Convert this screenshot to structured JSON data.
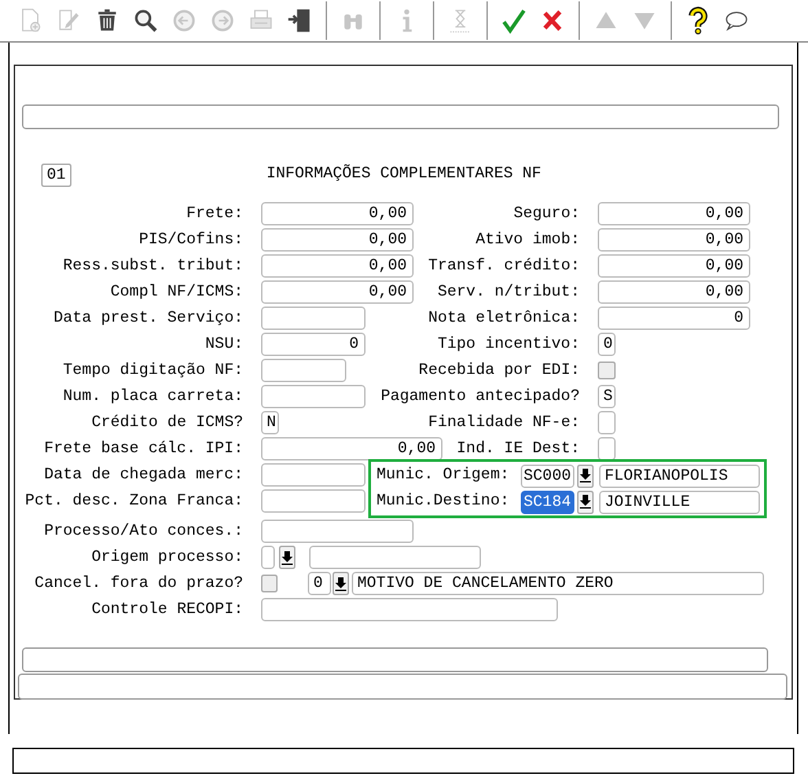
{
  "toolbar": [
    {
      "kind": "new",
      "disabled": true
    },
    {
      "kind": "edit",
      "disabled": true
    },
    {
      "kind": "delete",
      "disabled": false
    },
    {
      "kind": "search",
      "disabled": false
    },
    {
      "kind": "prev",
      "disabled": true
    },
    {
      "kind": "next",
      "disabled": true
    },
    {
      "kind": "print",
      "disabled": true
    },
    {
      "kind": "exit",
      "disabled": false
    },
    {
      "kind": "sep"
    },
    {
      "kind": "binoculars",
      "disabled": true
    },
    {
      "kind": "sep"
    },
    {
      "kind": "info",
      "disabled": true
    },
    {
      "kind": "sep"
    },
    {
      "kind": "hourglass",
      "disabled": true
    },
    {
      "kind": "sep"
    },
    {
      "kind": "confirm",
      "disabled": false
    },
    {
      "kind": "cancel",
      "disabled": false
    },
    {
      "kind": "sep"
    },
    {
      "kind": "up",
      "disabled": true
    },
    {
      "kind": "down",
      "disabled": true
    },
    {
      "kind": "sep"
    },
    {
      "kind": "help",
      "disabled": false
    },
    {
      "kind": "chat",
      "disabled": false
    }
  ],
  "form": {
    "page": "01",
    "title": "INFORMAÇÕES COMPLEMENTARES NF",
    "rows_top": [
      {
        "left": {
          "label": "Frete:",
          "fields": [
            {
              "kind": "text",
              "value": "0,00"
            }
          ]
        },
        "right": {
          "label": "Seguro:",
          "fields": [
            {
              "kind": "text",
              "value": "0,00"
            }
          ]
        }
      },
      {
        "left": {
          "label": "PIS/Cofins:",
          "fields": [
            {
              "kind": "text",
              "value": "0,00"
            }
          ]
        },
        "right": {
          "label": "Ativo imob:",
          "fields": [
            {
              "kind": "text",
              "value": "0,00"
            }
          ]
        }
      },
      {
        "left": {
          "label": "Ress.subst. tribut:",
          "fields": [
            {
              "kind": "text",
              "value": "0,00"
            }
          ]
        },
        "right": {
          "label": "Transf. crédito:",
          "fields": [
            {
              "kind": "text",
              "value": "0,00"
            }
          ]
        }
      },
      {
        "left": {
          "label": "Compl NF/ICMS:",
          "fields": [
            {
              "kind": "text",
              "value": "0,00"
            }
          ]
        },
        "right": {
          "label": "Serv. n/tribut:",
          "fields": [
            {
              "kind": "text",
              "value": "0,00"
            }
          ]
        }
      },
      {
        "left": {
          "label": "Data prest. Serviço:",
          "fields": [
            {
              "kind": "text"
            }
          ]
        },
        "right": {
          "label": "Nota eletrônica:",
          "fields": [
            {
              "kind": "text",
              "value": "0"
            }
          ]
        }
      },
      {
        "left": {
          "label": "NSU:",
          "fields": [
            {
              "kind": "text",
              "value": "0"
            }
          ]
        },
        "right": {
          "label": "Tipo incentivo:",
          "fields": [
            {
              "kind": "text",
              "value": "0"
            }
          ]
        }
      },
      {
        "left": {
          "label": "Tempo digitação NF:",
          "fields": [
            {
              "kind": "text"
            }
          ]
        },
        "right": {
          "label": "Recebida por EDI:",
          "fields": [
            {
              "kind": "checkbox",
              "checked": false
            }
          ]
        }
      },
      {
        "left": {
          "label": "Num. placa carreta:",
          "fields": [
            {
              "kind": "text"
            }
          ]
        },
        "right": {
          "label": "Pagamento antecipado?",
          "fields": [
            {
              "kind": "text",
              "value": "S"
            }
          ]
        }
      },
      {
        "left": {
          "label": "Crédito de ICMS?",
          "fields": [
            {
              "kind": "text",
              "value": "N"
            }
          ]
        },
        "right": {
          "label": "Finalidade NF-e:",
          "fields": [
            {
              "kind": "text"
            }
          ]
        }
      },
      {
        "left": {
          "label": "Frete base cálc. IPI:",
          "fields": [
            {
              "kind": "text",
              "value": "0,00"
            }
          ]
        },
        "right": {
          "label": "Ind. IE Dest:",
          "fields": [
            {
              "kind": "text"
            }
          ]
        }
      }
    ],
    "rows_mid": [
      {
        "left": {
          "label": "Data de chegada merc:",
          "fields": [
            {
              "kind": "text"
            }
          ]
        }
      },
      {
        "left": {
          "label": "Pct. desc. Zona Franca:",
          "fields": [
            {
              "kind": "text"
            }
          ]
        }
      }
    ],
    "municipios": [
      {
        "label": "Munic. Origem:",
        "code": "SC000",
        "name": "FLORIANOPOLIS",
        "selected": false
      },
      {
        "label": "Munic.Destino:",
        "code": "SC184",
        "name": "JOINVILLE",
        "selected": true
      }
    ],
    "rows_bottom": [
      {
        "left": {
          "label": "Processo/Ato conces.:",
          "fields": [
            {
              "kind": "text"
            }
          ]
        }
      },
      {
        "left": {
          "label": "Origem processo:",
          "fields": [
            {
              "kind": "text"
            },
            {
              "kind": "dropdown"
            },
            {
              "kind": "text"
            }
          ]
        }
      },
      {
        "left": {
          "label": "Cancel. fora do prazo?",
          "fields": [
            {
              "kind": "checkbox",
              "checked": false
            },
            {
              "kind": "text",
              "value": "0"
            },
            {
              "kind": "dropdown"
            },
            {
              "kind": "text",
              "value": "MOTIVO DE CANCELAMENTO ZERO"
            }
          ]
        }
      },
      {
        "left": {
          "label": "Controle RECOPI:",
          "fields": [
            {
              "kind": "text"
            }
          ]
        }
      }
    ]
  }
}
